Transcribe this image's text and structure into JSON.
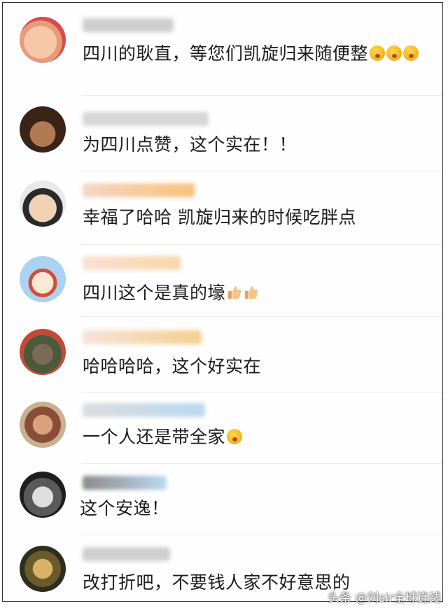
{
  "comments": [
    {
      "text": "四川的耿直，等您们凯旋归来随便整",
      "emoji_count": 3
    },
    {
      "text": "为四川点赞，这个实在！！"
    },
    {
      "text": "幸福了哈哈 凯旋归来的时候吃胖点"
    },
    {
      "text": "四川这个是真的壕",
      "thumbs_count": 2
    },
    {
      "text": "哈哈哈哈，这个好实在"
    },
    {
      "text": "一个人还是带全家",
      "emoji_count": 1
    },
    {
      "text": "这个安逸！"
    },
    {
      "text": "改打折吧，不要钱人家不好意思的"
    }
  ],
  "watermark": "头条 @刘sir全球连线",
  "colors": {
    "text": "#1c1c1c",
    "divider": "#ececec",
    "emoji": "#f2a100"
  }
}
